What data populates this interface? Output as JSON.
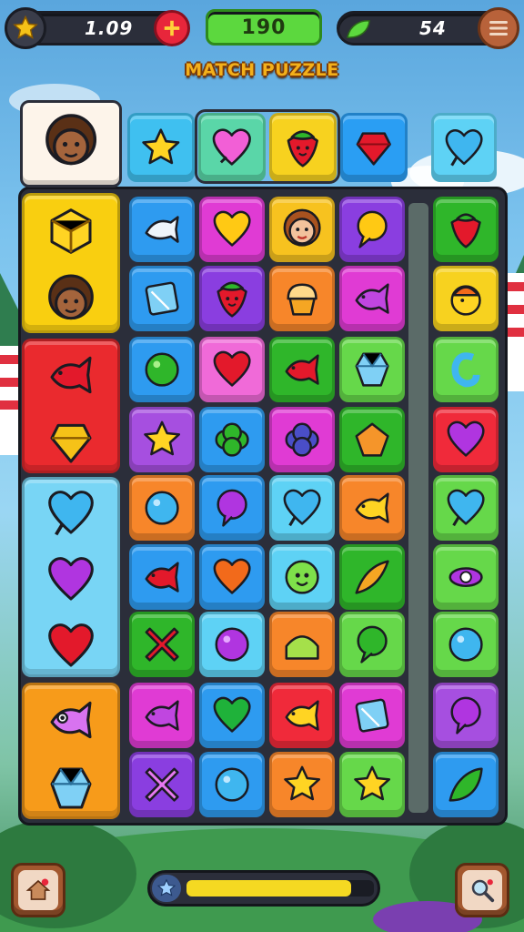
{
  "hud": {
    "coins": "1.09",
    "score": "190",
    "gems": "54",
    "menu_icon": "hamburger-menu-icon",
    "coin_icon": "star-badge-icon",
    "gem_icon": "green-leaf-icon",
    "add_icon": "plus-icon"
  },
  "title": "MATCH PUZZLE",
  "top_row": [
    {
      "icon": "afro-face",
      "bg": "#fdf4ea"
    },
    {
      "icon": "star",
      "bg": "#3fc0f0"
    },
    {
      "icon": "heart-bubble-pink",
      "bg": "#5ad6a8"
    },
    {
      "icon": "strawberry-face",
      "bg": "#f7d21f"
    },
    {
      "icon": "red-gem",
      "bg": "#2a9ef3"
    },
    {
      "icon": "speech-heart-blue",
      "bg": "#5ed2f5"
    }
  ],
  "left_groups": [
    {
      "bg": "#f9cf10",
      "items": [
        "yellow-cube",
        "afro-face"
      ]
    },
    {
      "bg": "#ea2a2e",
      "items": [
        "red-fish",
        "yellow-gem"
      ]
    },
    {
      "bg": "#78d5f5",
      "items": [
        "blue-speech-heart",
        "purple-heart",
        "red-heart"
      ]
    },
    {
      "bg": "#f79b1a",
      "items": [
        "pink-fish",
        "blue-crystal"
      ]
    }
  ],
  "grid": [
    [
      {
        "bg": "#2e9bf0",
        "icon": "white-fish"
      },
      {
        "bg": "#e03bd4",
        "icon": "yellow-heart"
      },
      {
        "bg": "#f7c21f",
        "icon": "girl-face"
      },
      {
        "bg": "#8a3ee0",
        "icon": "yellow-bubble"
      }
    ],
    [
      {
        "bg": "#2e9bf0",
        "icon": "blue-square"
      },
      {
        "bg": "#8a3ee0",
        "icon": "strawberry-face"
      },
      {
        "bg": "#f7862a",
        "icon": "cupcake"
      },
      {
        "bg": "#e03bd4",
        "icon": "purple-fish"
      }
    ],
    [
      {
        "bg": "#2e9bf0",
        "icon": "green-blob"
      },
      {
        "bg": "#f06ad8",
        "icon": "red-heart"
      },
      {
        "bg": "#2fb62a",
        "icon": "red-fish"
      },
      {
        "bg": "#66d84a",
        "icon": "blue-crystal"
      }
    ],
    [
      {
        "bg": "#a64fe0",
        "icon": "yellow-star"
      },
      {
        "bg": "#2e9bf0",
        "icon": "green-bush"
      },
      {
        "bg": "#e03bd4",
        "icon": "blueberry"
      },
      {
        "bg": "#2fb62a",
        "icon": "orange-pentagon"
      }
    ],
    [
      {
        "bg": "#f7862a",
        "icon": "blue-bubble"
      },
      {
        "bg": "#2e9bf0",
        "icon": "purple-bubble"
      },
      {
        "bg": "#5ed2f5",
        "icon": "blue-speech-heart"
      },
      {
        "bg": "#f7862a",
        "icon": "yellow-fish"
      }
    ],
    [
      {
        "bg": "#2e9bf0",
        "icon": "red-fish"
      },
      {
        "bg": "#2e9bf0",
        "icon": "orange-heart"
      },
      {
        "bg": "#5ed2f5",
        "icon": "green-face"
      },
      {
        "bg": "#2fb62a",
        "icon": "leaf-boomerang"
      }
    ],
    [
      {
        "bg": "#2fb62a",
        "icon": "red-x"
      },
      {
        "bg": "#5ed2f5",
        "icon": "purple-ball"
      },
      {
        "bg": "#f7862a",
        "icon": "green-dome"
      },
      {
        "bg": "#66d84a",
        "icon": "green-speech"
      }
    ],
    [
      {
        "bg": "#e03bd4",
        "icon": "purple-fish"
      },
      {
        "bg": "#2e9bf0",
        "icon": "green-heart"
      },
      {
        "bg": "#f02a3a",
        "icon": "yellow-fish"
      },
      {
        "bg": "#e03bd4",
        "icon": "blue-square"
      }
    ],
    [
      {
        "bg": "#8a3ee0",
        "icon": "pink-x"
      },
      {
        "bg": "#2e9bf0",
        "icon": "blue-bubble"
      },
      {
        "bg": "#f7862a",
        "icon": "yellow-star"
      },
      {
        "bg": "#66d84a",
        "icon": "yellow-star"
      }
    ]
  ],
  "right_col": [
    {
      "bg": "#2fb62a",
      "icon": "strawberry"
    },
    {
      "bg": "#f7d21f",
      "icon": "hat-fish"
    },
    {
      "bg": "#66d84a",
      "icon": "blue-hook"
    },
    {
      "bg": "#f02a3a",
      "icon": "purple-heart"
    },
    {
      "bg": "#66d84a",
      "icon": "blue-speech-heart"
    },
    {
      "bg": "#66d84a",
      "icon": "purple-spinner"
    },
    {
      "bg": "#66d84a",
      "icon": "blue-bubble"
    },
    {
      "bg": "#a64fe0",
      "icon": "purple-bubble"
    },
    {
      "bg": "#2e9bf0",
      "icon": "green-leaf"
    }
  ],
  "progress": {
    "fraction": 0.88
  },
  "bottom": {
    "home_icon": "home-icon",
    "search_icon": "magnifier-icon"
  }
}
